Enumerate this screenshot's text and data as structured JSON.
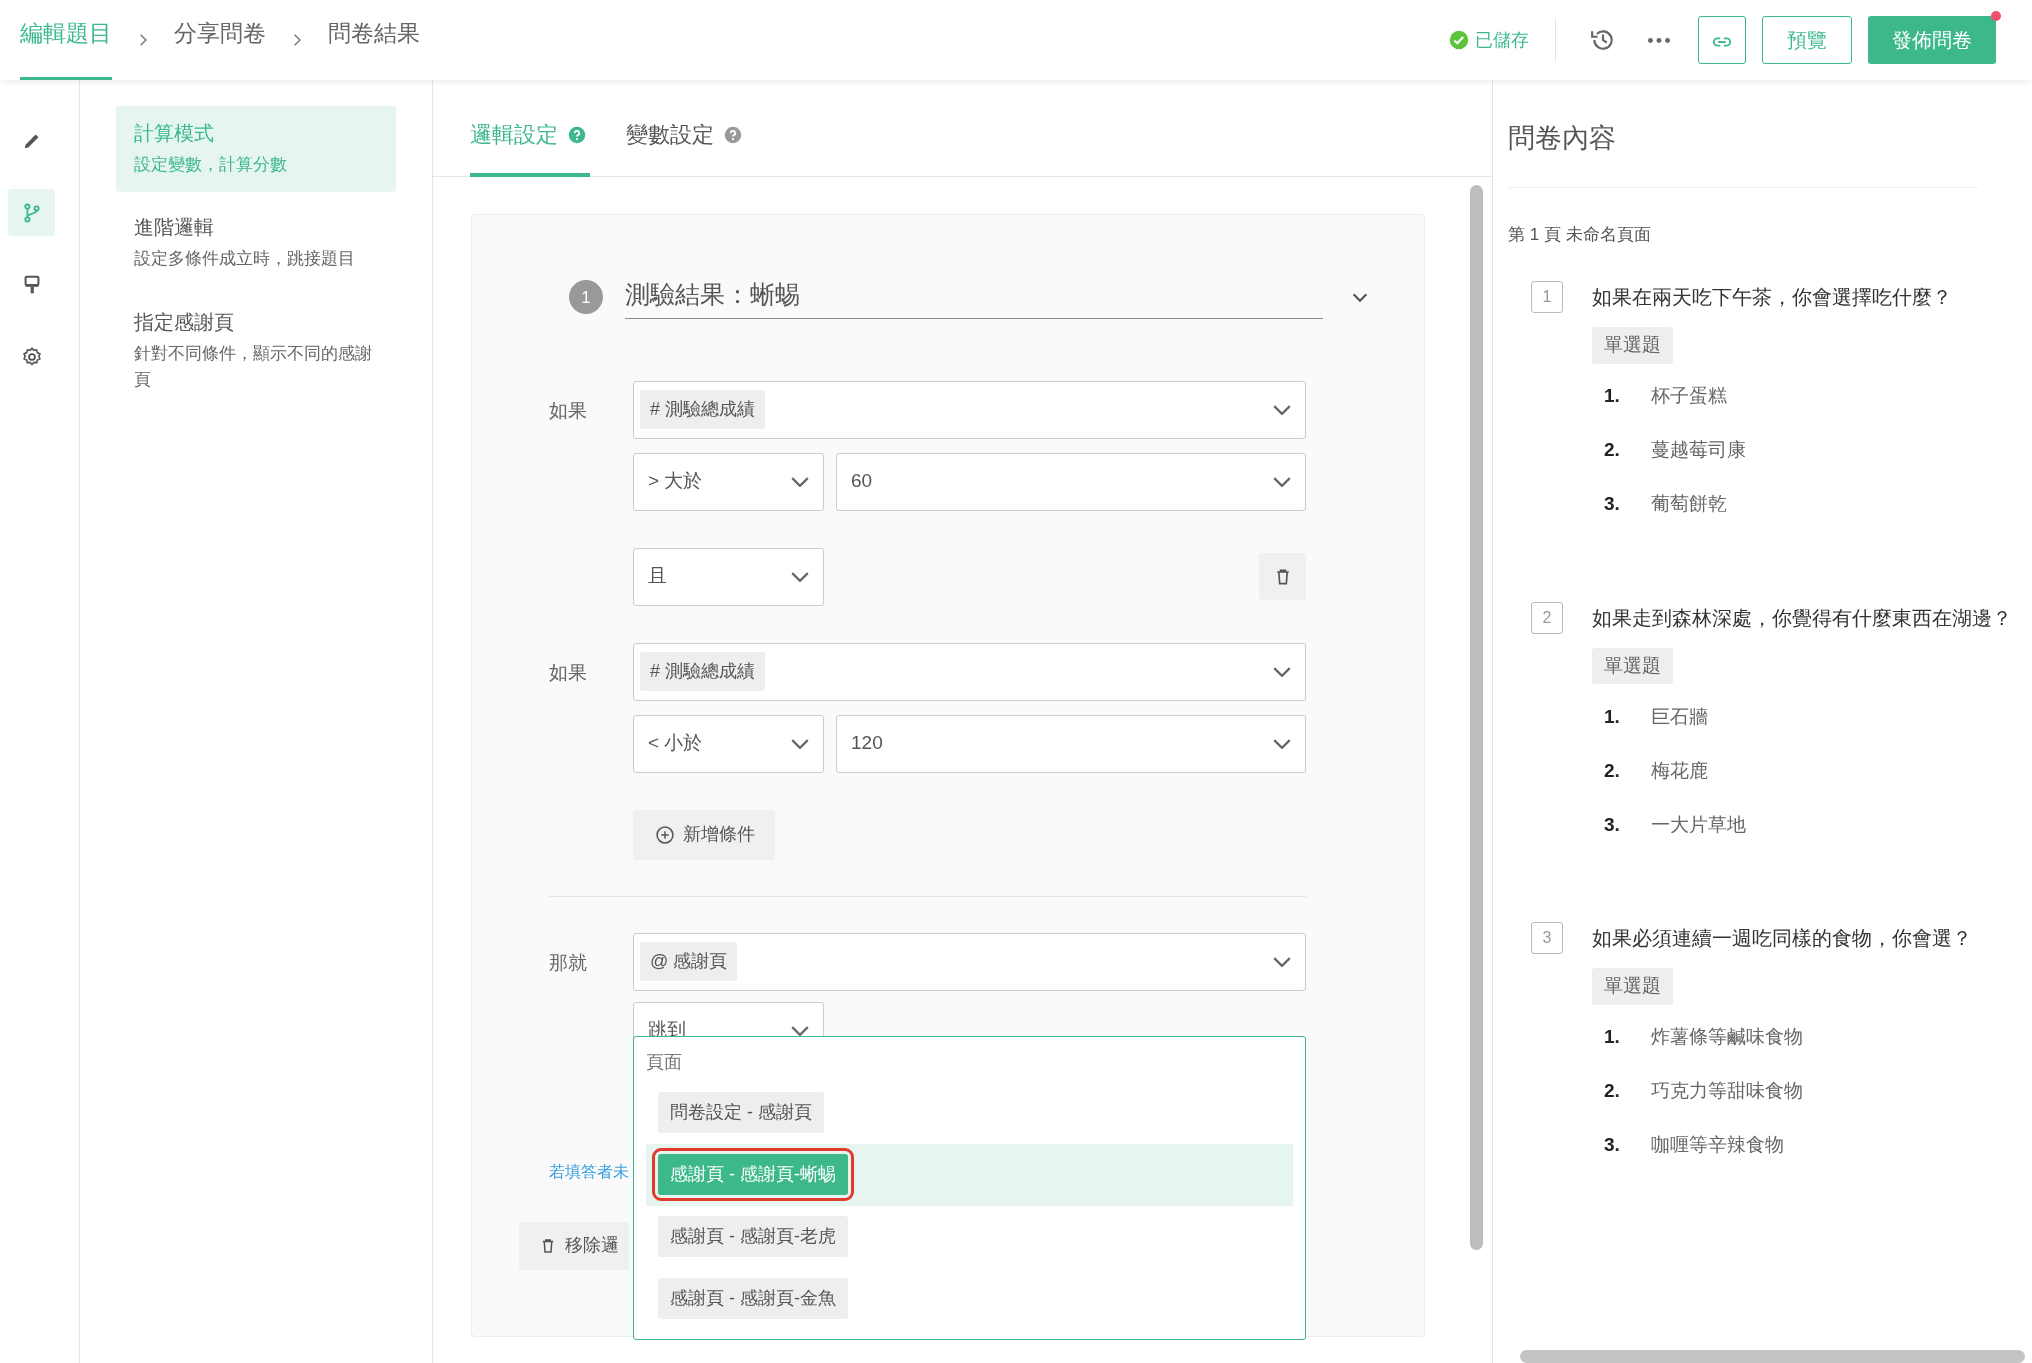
{
  "breadcrumb": [
    {
      "label": "編輯題目",
      "selected": true
    },
    {
      "label": "分享問卷",
      "selected": false
    },
    {
      "label": "問卷結果",
      "selected": false
    }
  ],
  "save_status": "已儲存",
  "header_buttons": {
    "preview": "預覽",
    "publish": "發佈問卷",
    "publish_notification": true
  },
  "rail": [
    {
      "kind": "edit",
      "selected": false
    },
    {
      "kind": "logic",
      "selected": true
    },
    {
      "kind": "style",
      "selected": false
    },
    {
      "kind": "settings",
      "selected": false
    }
  ],
  "modes": [
    {
      "title": "計算模式",
      "subtitle": "設定變數，計算分數",
      "selected": true
    },
    {
      "title": "進階邏輯",
      "subtitle": "設定多條件成立時，跳接題目",
      "selected": false
    },
    {
      "title": "指定感謝頁",
      "subtitle": "針對不同條件，顯示不同的感謝頁",
      "selected": false
    }
  ],
  "tabs": [
    {
      "label": "邏輯設定",
      "selected": true
    },
    {
      "label": "變數設定",
      "selected": false
    }
  ],
  "rule": {
    "number": "1",
    "title": "測驗結果：蜥蜴",
    "conditions": [
      {
        "label": "如果",
        "variable": "# 測驗總成績",
        "operator": "> 大於",
        "value": "60"
      },
      {
        "label": "如果",
        "variable": "# 測驗總成績",
        "operator": "< 小於",
        "value": "120"
      }
    ],
    "connectors": [
      "且"
    ],
    "add_condition": "新增條件",
    "action_label": "那就",
    "target": "@ 感謝頁",
    "action": "跳到",
    "note": "若填答者未",
    "remove": "移除邏"
  },
  "dropdown": {
    "group": "頁面",
    "options": [
      {
        "label": "問卷設定 - 感謝頁",
        "selected": false
      },
      {
        "label": "感謝頁 - 感謝頁-蜥蜴",
        "selected": true
      },
      {
        "label": "感謝頁 - 感謝頁-老虎",
        "selected": false
      },
      {
        "label": "感謝頁 - 感謝頁-金魚",
        "selected": false
      }
    ]
  },
  "content_panel": {
    "title": "問卷內容",
    "page": "第 1 頁 未命名頁面",
    "questions": [
      {
        "number": "1",
        "text": "如果在兩天吃下午茶，你會選擇吃什麼？",
        "type": "單選題",
        "options": [
          {
            "number": "1.",
            "label": "杯子蛋糕"
          },
          {
            "number": "2.",
            "label": "蔓越莓司康"
          },
          {
            "number": "3.",
            "label": "葡萄餅乾"
          }
        ]
      },
      {
        "number": "2",
        "text": "如果走到森林深處，你覺得有什麼東西在湖邊？",
        "type": "單選題",
        "options": [
          {
            "number": "1.",
            "label": "巨石牆"
          },
          {
            "number": "2.",
            "label": "梅花鹿"
          },
          {
            "number": "3.",
            "label": "一大片草地"
          }
        ]
      },
      {
        "number": "3",
        "text": "如果必須連續一週吃同樣的食物，你會選？",
        "type": "單選題",
        "options": [
          {
            "number": "1.",
            "label": "炸薯條等鹹味食物"
          },
          {
            "number": "2.",
            "label": "巧克力等甜味食物"
          },
          {
            "number": "3.",
            "label": "咖喱等辛辣食物"
          }
        ]
      }
    ]
  }
}
